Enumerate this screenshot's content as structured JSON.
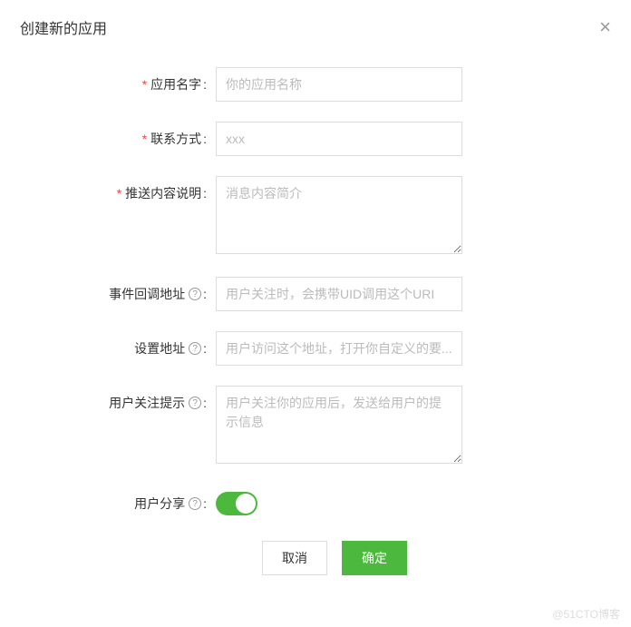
{
  "header": {
    "title": "创建新的应用"
  },
  "form": {
    "appName": {
      "label": "应用名字",
      "placeholder": "你的应用名称"
    },
    "contact": {
      "label": "联系方式",
      "placeholder": "xxx"
    },
    "pushDesc": {
      "label": "推送内容说明",
      "placeholder": "消息内容简介"
    },
    "callback": {
      "label": "事件回调地址",
      "placeholder": "用户关注时，会携带UID调用这个URI"
    },
    "settingAddr": {
      "label": "设置地址",
      "placeholder": "用户访问这个地址，打开你自定义的要..."
    },
    "followTip": {
      "label": "用户关注提示",
      "placeholder": "用户关注你的应用后，发送给用户的提示信息"
    },
    "userShare": {
      "label": "用户分享"
    }
  },
  "actions": {
    "cancel": "取消",
    "confirm": "确定"
  },
  "watermark": "@51CTO博客"
}
